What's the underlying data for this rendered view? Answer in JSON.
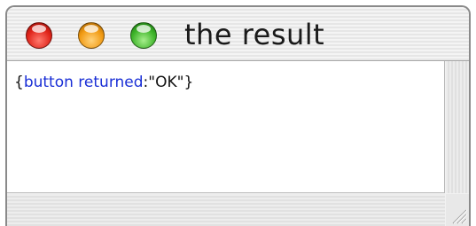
{
  "window": {
    "title": "the result"
  },
  "result": {
    "open_brace": "{",
    "keyword": "button returned",
    "colon": ":",
    "value": "\"OK\"",
    "close_brace": "}"
  },
  "colors": {
    "keyword": "#1a2fd6",
    "close_button": "#e0241a",
    "minimize_button": "#f19a12",
    "zoom_button": "#3eb42a"
  },
  "icons": {
    "close": "close-button-icon",
    "minimize": "minimize-button-icon",
    "zoom": "zoom-button-icon",
    "resize": "resize-grip-icon"
  }
}
